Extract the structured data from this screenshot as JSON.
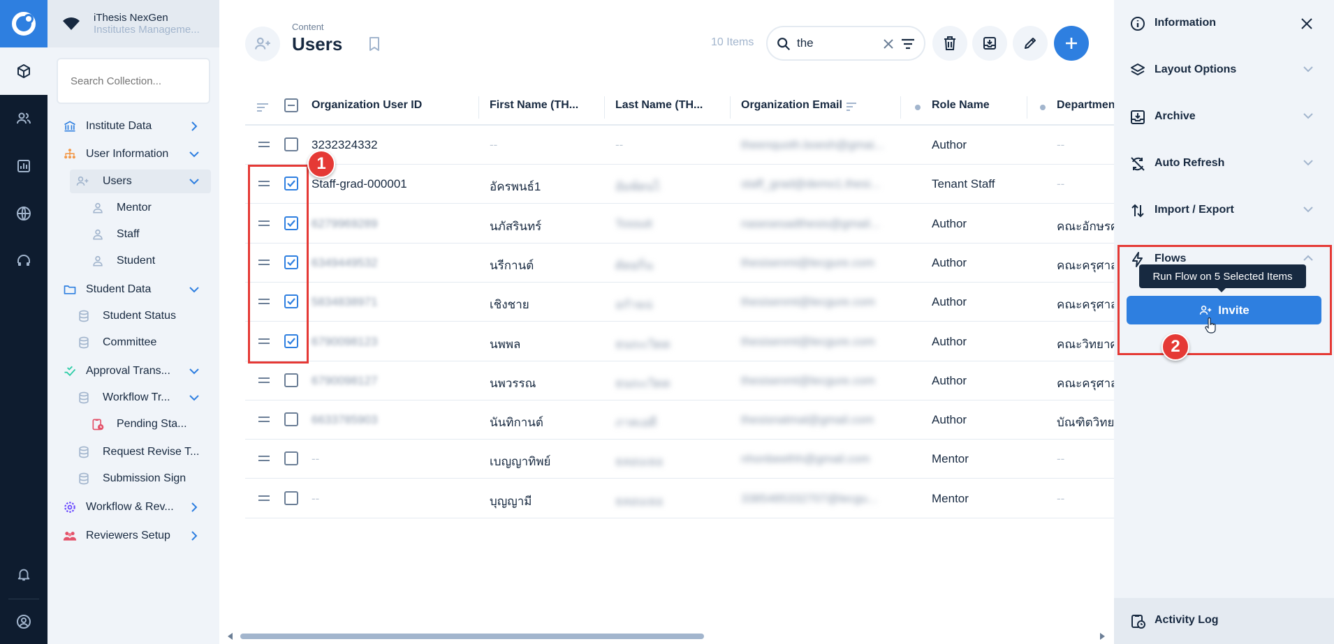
{
  "project": {
    "name": "iThesis NexGen",
    "subtitle": "Institutes Manageme..."
  },
  "nav": {
    "search_placeholder": "Search Collection...",
    "items": [
      {
        "label": "Institute Data",
        "icon": "bank-icon"
      },
      {
        "label": "User Information",
        "icon": "org-chart-icon"
      },
      {
        "label": "Users",
        "icon": "user-add-icon"
      },
      {
        "label": "Mentor",
        "icon": "person-icon"
      },
      {
        "label": "Staff",
        "icon": "person-icon"
      },
      {
        "label": "Student",
        "icon": "person-icon"
      },
      {
        "label": "Student Data",
        "icon": "folder-icon"
      },
      {
        "label": "Student Status",
        "icon": "database-icon"
      },
      {
        "label": "Committee",
        "icon": "database-icon"
      },
      {
        "label": "Approval Trans...",
        "icon": "approval-icon"
      },
      {
        "label": "Workflow Tr...",
        "icon": "database-icon"
      },
      {
        "label": "Pending Sta...",
        "icon": "clipboard-clock-icon"
      },
      {
        "label": "Request Revise T...",
        "icon": "database-icon"
      },
      {
        "label": "Submission Sign",
        "icon": "database-icon"
      },
      {
        "label": "Workflow & Rev...",
        "icon": "gear-icon"
      },
      {
        "label": "Reviewers Setup",
        "icon": "team-icon"
      }
    ]
  },
  "header": {
    "breadcrumb": "Content",
    "title": "Users",
    "count": "10 Items",
    "search_value": "the"
  },
  "table": {
    "columns": [
      "Organization User ID",
      "First Name (TH...",
      "Last Name (TH...",
      "Organization Email",
      "Role Name",
      "Departmen"
    ],
    "rows": [
      {
        "id": "3232324332",
        "first": "--",
        "last": "--",
        "email": "theenquoth.boesh@gmai...",
        "role": "Author",
        "dept": "--",
        "checked": false
      },
      {
        "id": "Staff-grad-000001",
        "first": "อัครพนธ์1",
        "last": "อัมพ์ดนไ",
        "email": "staff_grad@demo1.thesi...",
        "role": "Tenant Staff",
        "dept": "--",
        "checked": true
      },
      {
        "id": "6279969289",
        "first": "นภัสรินทร์",
        "last": "Tossuit",
        "email": "nasesesadthesis@gmail...",
        "role": "Author",
        "dept": "คณะอักษรศาสตร",
        "checked": true
      },
      {
        "id": "6349449532",
        "first": "นรีกานต์",
        "last": "ดัดยกิ่น",
        "email": "thesisenmi@lecgure.com",
        "role": "Author",
        "dept": "คณะครุศาสตร์",
        "checked": true
      },
      {
        "id": "5834838971",
        "first": "เชิงชาย",
        "last": "อกำฉน่",
        "email": "thesisenmt@lecgure.com",
        "role": "Author",
        "dept": "คณะครุศาสตร์",
        "checked": true
      },
      {
        "id": "6790098123",
        "first": "นพพล",
        "last": "ธนถะเวิดด",
        "email": "thesisenmt@lecgure.com",
        "role": "Author",
        "dept": "คณะวิทยาศาสต",
        "checked": true
      },
      {
        "id": "6790098127",
        "first": "นพวรรณ",
        "last": "ธนถะเวิดด",
        "email": "thesisenmt@lecgure.com",
        "role": "Author",
        "dept": "คณะครุศาสตร์",
        "checked": false
      },
      {
        "id": "6633785903",
        "first": "นันทิกานต์",
        "last": "ภาคเอดี",
        "email": "thesisnatmal@gmail.com",
        "role": "Author",
        "dept": "บัณฑิตวิทยาลัย",
        "checked": false
      },
      {
        "id": "--",
        "first": "เบญญาทิพย์",
        "last": "ธลอบเธอ",
        "email": "nhonbeethh@gmail.com",
        "role": "Mentor",
        "dept": "--",
        "checked": false
      },
      {
        "id": "--",
        "first": "บุญญามี",
        "last": "ธลอบเธอ",
        "email": "3385485332707@lecgu...",
        "role": "Mentor",
        "dept": "--",
        "checked": false
      }
    ]
  },
  "sidebar": {
    "items": [
      {
        "label": "Information",
        "icon": "info-icon"
      },
      {
        "label": "Layout Options",
        "icon": "layers-icon"
      },
      {
        "label": "Archive",
        "icon": "archive-icon"
      },
      {
        "label": "Auto Refresh",
        "icon": "refresh-off-icon"
      },
      {
        "label": "Import / Export",
        "icon": "import-export-icon"
      },
      {
        "label": "Flows",
        "icon": "bolt-icon"
      }
    ],
    "tooltip": "Run Flow on 5 Selected Items",
    "invite_label": "Invite",
    "activity_log": "Activity Log"
  },
  "annotations": {
    "badge1": "1",
    "badge2": "2"
  },
  "colors": {
    "accent": "#2e7fe0",
    "annotation": "#e53935",
    "rail": "#0e1c2f"
  }
}
